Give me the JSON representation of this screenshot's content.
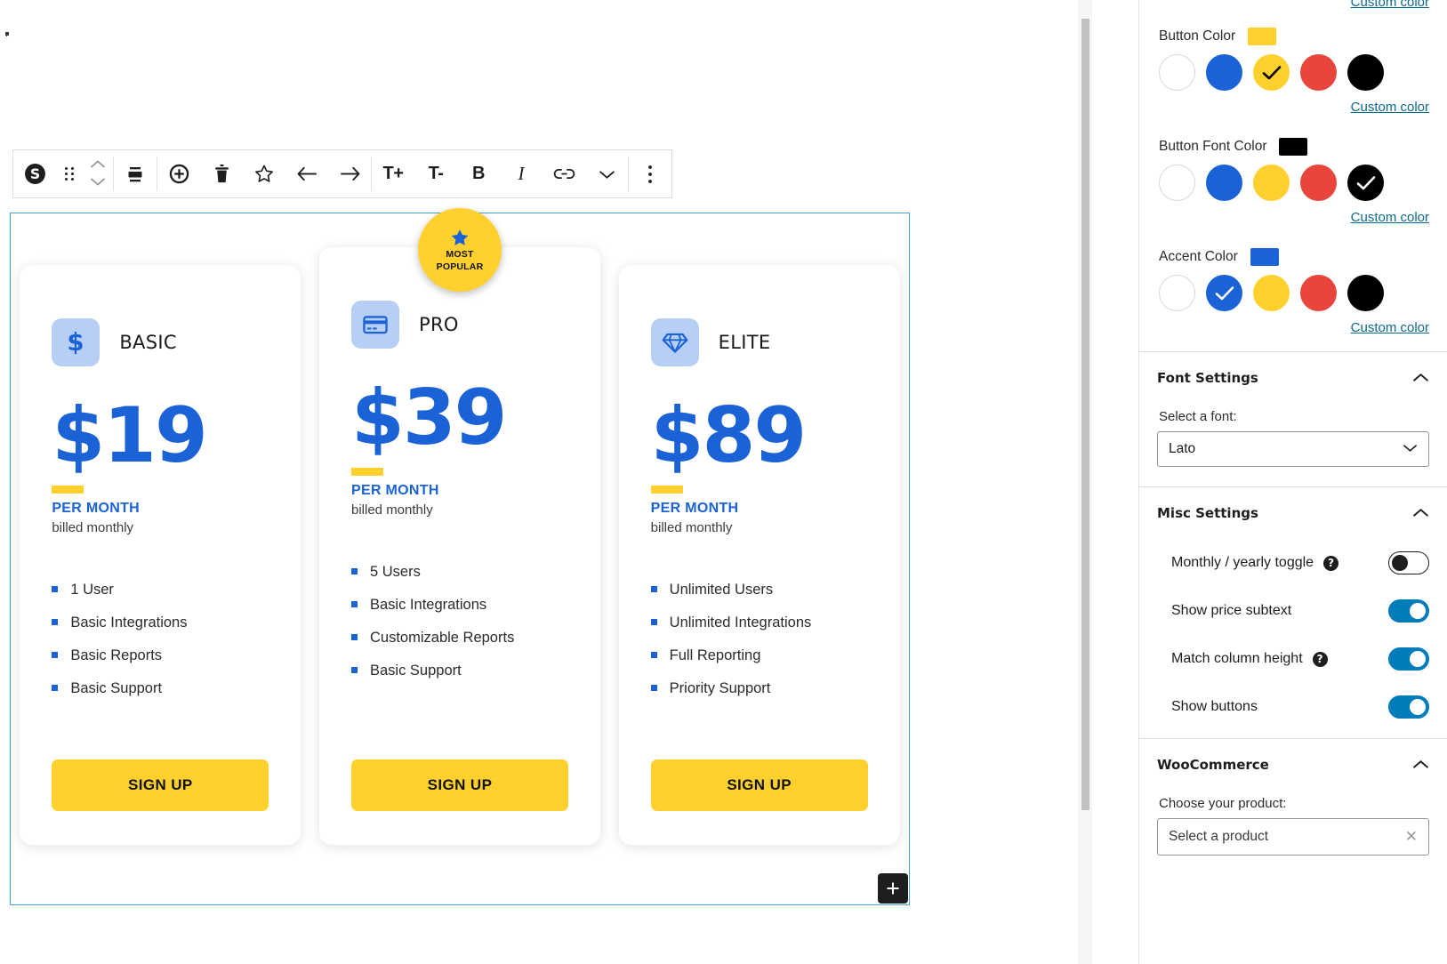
{
  "editor": {
    "stray_mark": ".",
    "toolbar": {
      "block_type_icon": "pricing-dollar-icon",
      "drag_label": "drag-handle",
      "move_up_label": "move-up",
      "move_down_label": "move-down",
      "items": [
        {
          "name": "align-icon",
          "label": ""
        },
        {
          "name": "add-column-icon",
          "label": ""
        },
        {
          "name": "delete-column-icon",
          "label": ""
        },
        {
          "name": "star-icon",
          "label": ""
        },
        {
          "name": "move-left-icon",
          "label": ""
        },
        {
          "name": "move-right-icon",
          "label": ""
        },
        {
          "name": "font-size-increase",
          "label": "T+"
        },
        {
          "name": "font-size-decrease",
          "label": "T-"
        },
        {
          "name": "bold",
          "label": "B"
        },
        {
          "name": "italic",
          "label": "I"
        },
        {
          "name": "link-icon",
          "label": ""
        },
        {
          "name": "more-formatting-chevron",
          "label": ""
        },
        {
          "name": "block-options-ellipsis",
          "label": ""
        }
      ]
    },
    "add_block_label": "+",
    "most_popular_badge": {
      "line1": "MOST",
      "line2": "POPULAR"
    },
    "plans": [
      {
        "id": "basic",
        "icon": "dollar-sign-icon",
        "title": "BASIC",
        "price": "$19",
        "period": "PER MONTH",
        "subtext": "billed monthly",
        "features": [
          "1 User",
          "Basic Integrations",
          "Basic Reports",
          "Basic Support"
        ],
        "button_label": "SIGN UP",
        "featured": false
      },
      {
        "id": "pro",
        "icon": "credit-card-icon",
        "title": "PRO",
        "price": "$39",
        "period": "PER MONTH",
        "subtext": "billed monthly",
        "features": [
          "5 Users",
          "Basic Integrations",
          "Customizable Reports",
          "Basic Support"
        ],
        "button_label": "SIGN UP",
        "featured": true
      },
      {
        "id": "elite",
        "icon": "diamond-icon",
        "title": "ELITE",
        "price": "$89",
        "period": "PER MONTH",
        "subtext": "billed monthly",
        "features": [
          "Unlimited Users",
          "Unlimited Integrations",
          "Full Reporting",
          "Priority Support"
        ],
        "button_label": "SIGN UP",
        "featured": false
      }
    ]
  },
  "sidebar": {
    "top_custom_color_link": "Custom color",
    "color_groups": [
      {
        "name": "button-color",
        "label": "Button Color",
        "current": "#ffd02e",
        "swatches": [
          "#ffffff",
          "#1a62d6",
          "#ffd02e",
          "#e8453c",
          "#000000"
        ],
        "selected_index": 2,
        "check_color": "#000000",
        "custom_link": "Custom color"
      },
      {
        "name": "button-font-color",
        "label": "Button Font Color",
        "current": "#000000",
        "swatches": [
          "#ffffff",
          "#1a62d6",
          "#ffd02e",
          "#e8453c",
          "#000000"
        ],
        "selected_index": 4,
        "check_color": "#ffffff",
        "custom_link": "Custom color"
      },
      {
        "name": "accent-color",
        "label": "Accent Color",
        "current": "#1a62d6",
        "swatches": [
          "#ffffff",
          "#1a62d6",
          "#ffd02e",
          "#e8453c",
          "#000000"
        ],
        "selected_index": 1,
        "check_color": "#ffffff",
        "custom_link": "Custom color"
      }
    ],
    "font_settings": {
      "title": "Font Settings",
      "field_label": "Select a font:",
      "selected_font": "Lato"
    },
    "misc_settings": {
      "title": "Misc Settings",
      "toggles": [
        {
          "name": "monthly-yearly-toggle",
          "label": "Monthly / yearly toggle",
          "has_help": true,
          "on": false
        },
        {
          "name": "show-price-subtext-toggle",
          "label": "Show price subtext",
          "has_help": false,
          "on": true
        },
        {
          "name": "match-column-height-toggle",
          "label": "Match column height",
          "has_help": true,
          "on": true
        },
        {
          "name": "show-buttons-toggle",
          "label": "Show buttons",
          "has_help": false,
          "on": true
        }
      ]
    },
    "woocommerce": {
      "title": "WooCommerce",
      "field_label": "Choose your product:",
      "product_placeholder": "Select a product"
    }
  }
}
